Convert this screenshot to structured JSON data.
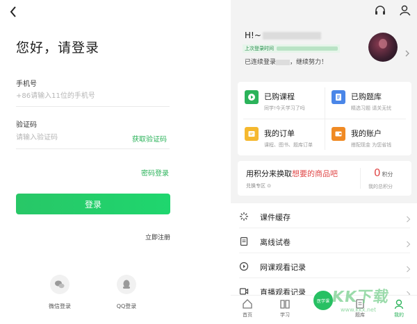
{
  "login": {
    "title": "您好，请登录",
    "phone_label": "手机号",
    "phone_placeholder": "+86请输入11位的手机号",
    "code_label": "验证码",
    "code_placeholder": "请输入验证码",
    "get_code": "获取验证码",
    "password_login": "密码登录",
    "login_button": "登录",
    "register": "立即注册",
    "social": [
      {
        "label": "微信登录",
        "icon": "wechat-icon"
      },
      {
        "label": "QQ登录",
        "icon": "qq-icon"
      }
    ]
  },
  "profile": {
    "greeting": "H!~",
    "last_login_label": "上次登录时间",
    "streak_prefix": "已连续登录",
    "streak_suffix": "，继续努力！",
    "top_icons": [
      "headset-icon",
      "user-settings-icon"
    ]
  },
  "grid": [
    {
      "title": "已购课程",
      "subtitle": "同学!今天学习了吗",
      "color": "#2bb35a",
      "icon": "play-icon"
    },
    {
      "title": "已购题库",
      "subtitle": "精选习题 请关无忧",
      "color": "#4a86e8",
      "icon": "document-icon"
    },
    {
      "title": "我的订单",
      "subtitle": "课程、图书、题库订单",
      "color": "#f5b82e",
      "icon": "order-icon"
    },
    {
      "title": "我的账户",
      "subtitle": "搭配现金 为您省钱",
      "color": "#f08a24",
      "icon": "wallet-icon"
    }
  ],
  "points": {
    "text_prefix": "用积分来换取",
    "text_highlight": "想要的商品吧",
    "exchange_link": "兑换专区",
    "value": "0",
    "unit": "积分",
    "label": "我的总积分"
  },
  "list": [
    {
      "label": "课件缓存",
      "icon": "loading-icon"
    },
    {
      "label": "离线试卷",
      "icon": "exam-icon"
    },
    {
      "label": "网课观看记录",
      "icon": "play-record-icon"
    },
    {
      "label": "直播观看记录",
      "icon": "live-icon"
    }
  ],
  "tabbar": [
    {
      "label": "首页",
      "icon": "home-icon"
    },
    {
      "label": "学习",
      "icon": "book-icon"
    },
    {
      "label": "医学课",
      "icon": "center-icon"
    },
    {
      "label": "题库",
      "icon": "quiz-icon"
    },
    {
      "label": "我的",
      "icon": "me-icon"
    }
  ],
  "watermark": {
    "big": "KK下载",
    "small": "www.kkx.net"
  },
  "colors": {
    "accent": "#2bb35a",
    "red": "#e04848"
  }
}
